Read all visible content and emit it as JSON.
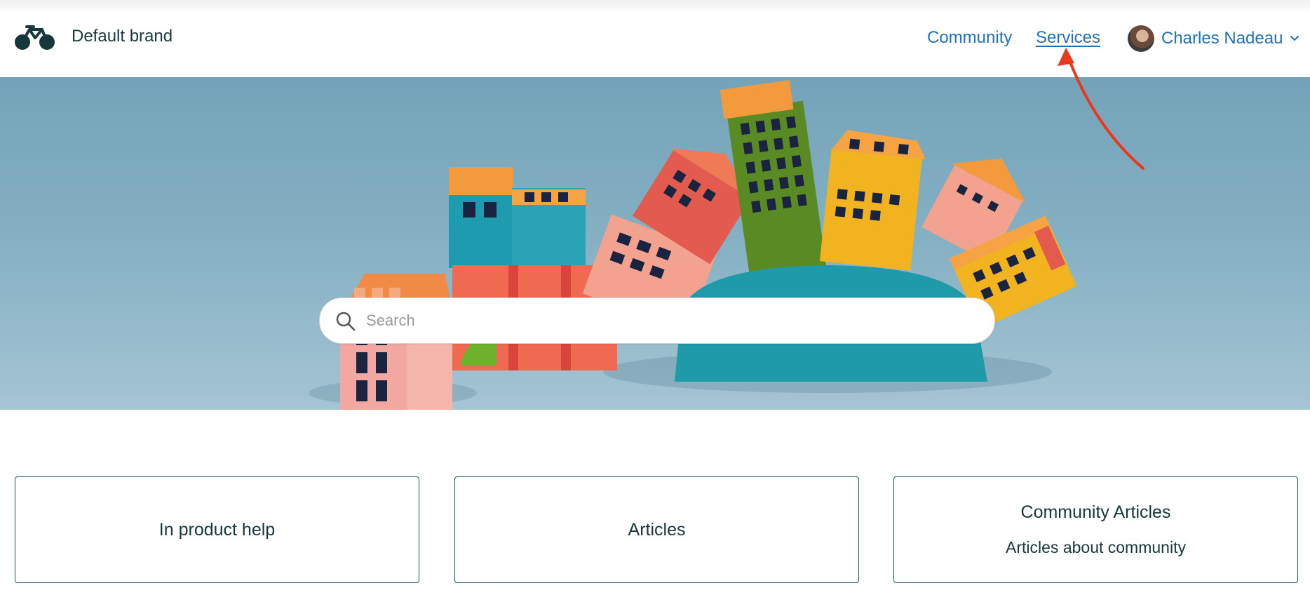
{
  "header": {
    "brand_name": "Default brand",
    "nav": {
      "community_label": "Community",
      "services_label": "Services"
    },
    "user": {
      "name": "Charles Nadeau"
    }
  },
  "hero": {
    "search": {
      "placeholder": "Search",
      "value": ""
    }
  },
  "cards": [
    {
      "title": "In product help",
      "description": ""
    },
    {
      "title": "Articles",
      "description": ""
    },
    {
      "title": "Community Articles",
      "description": "Articles about community"
    }
  ],
  "colors": {
    "link": "#1f73b7",
    "text": "#17383b",
    "card_border": "#1f5a5e",
    "annotation_arrow": "#e8391d"
  }
}
